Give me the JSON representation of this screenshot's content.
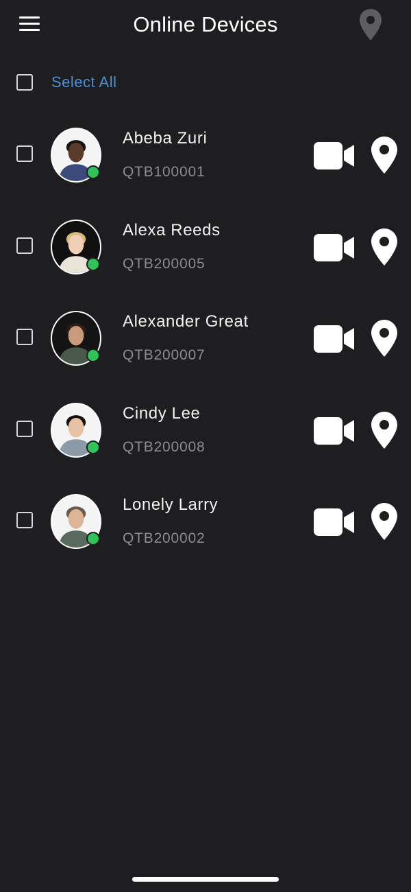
{
  "header": {
    "title": "Online Devices",
    "menu_icon": "hamburger-menu-icon",
    "location_icon": "map-pin-icon"
  },
  "select_all": {
    "label": "Select All",
    "checked": false
  },
  "devices": [
    {
      "name": "Abeba Zuri",
      "id": "QTB100001",
      "status": "online",
      "checked": false,
      "avatar": "profile-photo"
    },
    {
      "name": "Alexa Reeds",
      "id": "QTB200005",
      "status": "online",
      "checked": false,
      "avatar": "profile-photo"
    },
    {
      "name": "Alexander Great",
      "id": "QTB200007",
      "status": "online",
      "checked": false,
      "avatar": "profile-photo"
    },
    {
      "name": "Cindy Lee",
      "id": "QTB200008",
      "status": "online",
      "checked": false,
      "avatar": "profile-photo"
    },
    {
      "name": "Lonely Larry",
      "id": "QTB200002",
      "status": "online",
      "checked": false,
      "avatar": "profile-photo"
    }
  ],
  "row_actions": {
    "video_icon": "video-camera-icon",
    "location_icon": "map-pin-icon"
  },
  "colors": {
    "background": "#1e1e20",
    "accent": "#4b8fd6",
    "online": "#2fc35a",
    "text_primary": "#f2f2f2",
    "text_secondary": "#8c8c8f",
    "header_pin": "#5e5e61"
  }
}
